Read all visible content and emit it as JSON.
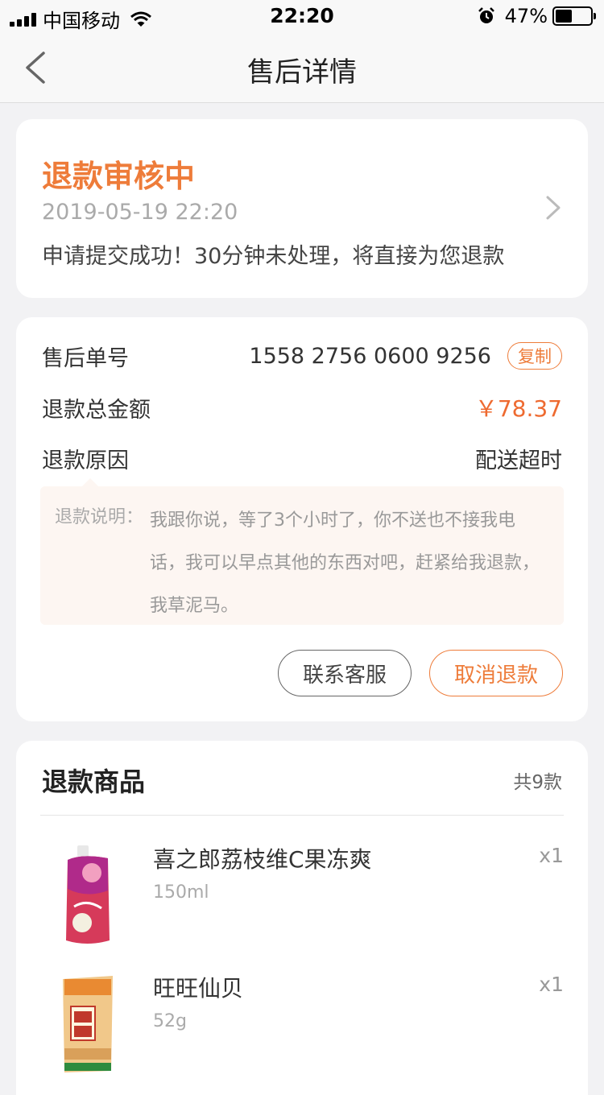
{
  "status_bar": {
    "carrier": "中国移动",
    "time": "22:20",
    "battery": "47%",
    "battery_level": 0.47
  },
  "nav": {
    "title": "售后详情"
  },
  "refund_status": {
    "title": "退款审核中",
    "time": "2019-05-19 22:20",
    "message": "申请提交成功！30分钟未处理，将直接为您退款"
  },
  "details": {
    "order_label": "售后单号",
    "order_number": "1558 2756 0600 9256",
    "copy_label": "复制",
    "amount_label": "退款总金额",
    "amount": "￥78.37",
    "reason_label": "退款原因",
    "reason": "配送超时",
    "note_label": "退款说明：",
    "note": "我跟你说，等了3个小时了，你不送也不接我电话，我可以早点其他的东西对吧，赶紧给我退款，我草泥马。",
    "contact_button": "联系客服",
    "cancel_button": "取消退款"
  },
  "goods": {
    "title": "退款商品",
    "count": "共9款",
    "items": [
      {
        "name": "喜之郎荔枝维C果冻爽",
        "spec": "150ml",
        "qty": "x1"
      },
      {
        "name": "旺旺仙贝",
        "spec": "52g",
        "qty": "x1"
      }
    ]
  },
  "colors": {
    "accent": "#ee7c3a",
    "price": "#ee6a30",
    "background": "#f2f2f4"
  }
}
